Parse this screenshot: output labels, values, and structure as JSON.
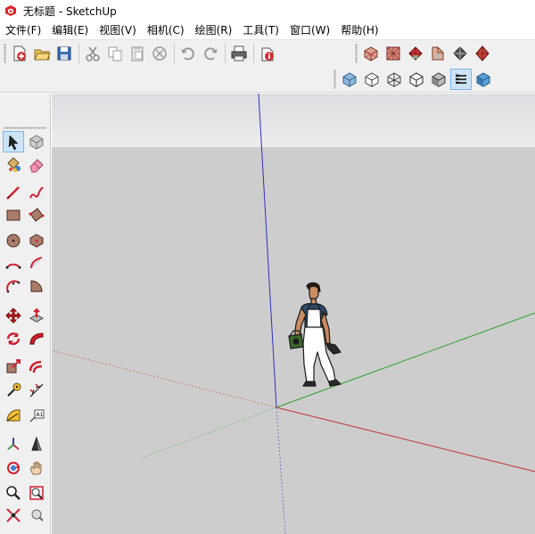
{
  "window": {
    "title": "无标题 - SketchUp",
    "logo_icon": "sketchup-logo-icon"
  },
  "menu": [
    {
      "id": "file",
      "label": "文件(F)"
    },
    {
      "id": "edit",
      "label": "编辑(E)"
    },
    {
      "id": "view",
      "label": "视图(V)"
    },
    {
      "id": "camera",
      "label": "相机(C)"
    },
    {
      "id": "draw",
      "label": "绘图(R)"
    },
    {
      "id": "tools",
      "label": "工具(T)"
    },
    {
      "id": "window",
      "label": "窗口(W)"
    },
    {
      "id": "help",
      "label": "帮助(H)"
    }
  ],
  "standard_toolbar": [
    "new-file-icon",
    "open-folder-icon",
    "save-icon",
    "cut-icon",
    "copy-icon",
    "paste-icon",
    "erase-icon",
    "undo-icon",
    "redo-icon",
    "print-icon",
    "model-info-icon"
  ],
  "views_toolbar": [
    "iso-view-icon",
    "top-view-icon",
    "front-view-icon",
    "right-view-icon",
    "back-view-icon",
    "left-view-icon"
  ],
  "styles_toolbar": {
    "items": [
      "xray-style-icon",
      "back-edges-style-icon",
      "wireframe-style-icon",
      "hidden-line-style-icon",
      "shaded-style-icon",
      "shaded-textures-style-icon",
      "monochrome-style-icon"
    ],
    "active": "shaded-textures-style-icon"
  },
  "left_tools": {
    "items": [
      "select-icon",
      "make-component-icon",
      "paint-bucket-icon",
      "eraser-icon",
      "line-icon",
      "freehand-icon",
      "rectangle-icon",
      "rotated-rectangle-icon",
      "circle-icon",
      "polygon-icon",
      "arc-icon",
      "two-point-arc-icon",
      "three-point-arc-icon",
      "pie-icon",
      "move-icon",
      "push-pull-icon",
      "rotate-icon",
      "follow-me-icon",
      "scale-icon",
      "offset-icon",
      "tape-measure-icon",
      "dimension-icon",
      "protractor-icon",
      "text-icon",
      "axes-icon",
      "3d-text-icon",
      "orbit-icon",
      "pan-icon",
      "zoom-icon",
      "zoom-window-icon",
      "zoom-extents-icon",
      "previous-view-icon"
    ],
    "active": "select-icon"
  },
  "viewport": {
    "sky_color": "#e8e8ea",
    "ground_color": "#cdcdcd",
    "axis_red": "#c03030",
    "axis_green": "#30a030",
    "axis_blue": "#3030c0",
    "scale_figure": "person-figure-icon"
  }
}
